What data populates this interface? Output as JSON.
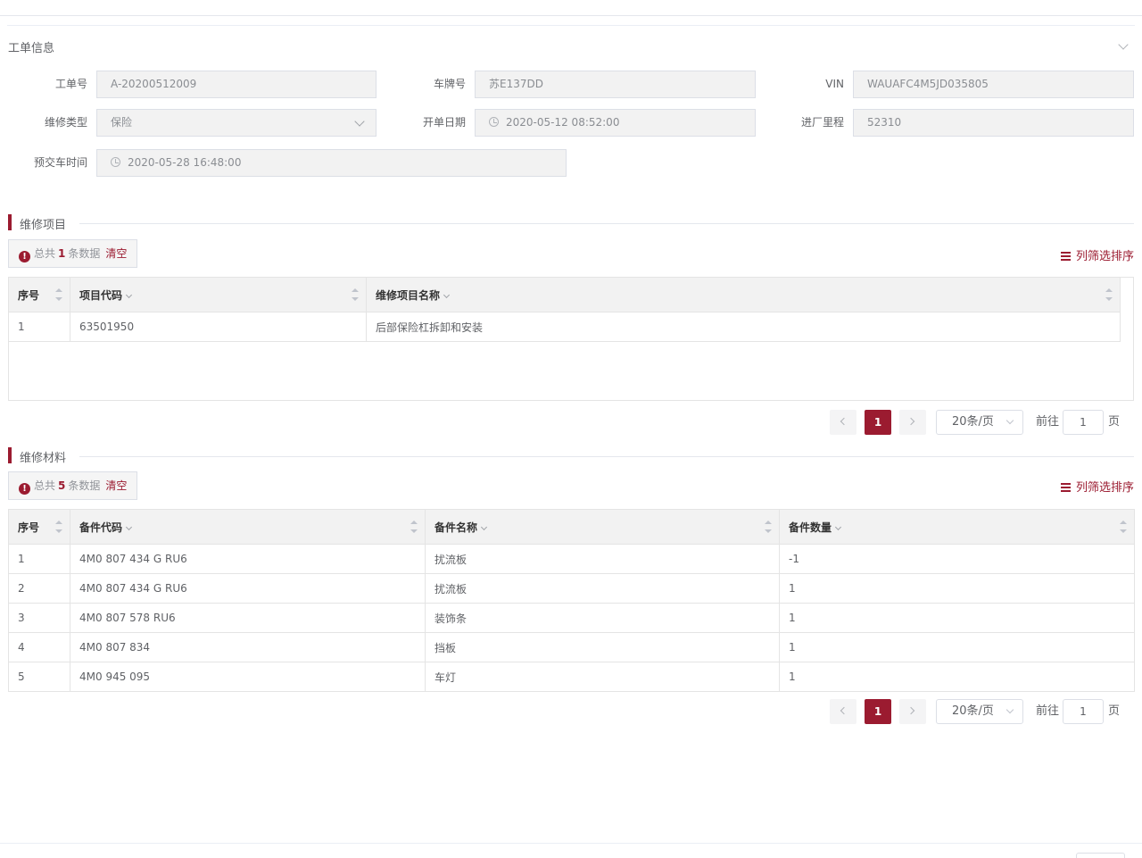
{
  "work_order": {
    "section_title": "工单信息",
    "order_no_label": "工单号",
    "order_no": "A-20200512009",
    "plate_label": "车牌号",
    "plate": "苏E137DD",
    "vin_label": "VIN",
    "vin": "WAUAFC4M5JD035805",
    "repair_type_label": "维修类型",
    "repair_type": "保险",
    "open_date_label": "开单日期",
    "open_date": "2020-05-12 08:52:00",
    "mileage_label": "进厂里程",
    "mileage": "52310",
    "delivery_label": "预交车时间",
    "delivery_time": "2020-05-28 16:48:00"
  },
  "repair_items": {
    "title": "维修项目",
    "summary": {
      "prefix": "总共",
      "count": "1",
      "suffix": "条数据",
      "clear": "清空"
    },
    "column_sort": "列筛选排序",
    "columns": [
      "序号",
      "项目代码",
      "维修项目名称"
    ],
    "rows": [
      [
        "1",
        "63501950",
        "后部保险杠拆卸和安装"
      ]
    ],
    "pager": {
      "current": "1",
      "page_size": "20条/页",
      "goto_label": "前往",
      "goto_value": "1",
      "page_suffix": "页"
    }
  },
  "repair_materials": {
    "title": "维修材料",
    "summary": {
      "prefix": "总共",
      "count": "5",
      "suffix": "条数据",
      "clear": "清空"
    },
    "column_sort": "列筛选排序",
    "columns": [
      "序号",
      "备件代码",
      "备件名称",
      "备件数量"
    ],
    "rows": [
      [
        "1",
        "4M0 807 434 G RU6",
        "扰流板",
        "-1"
      ],
      [
        "2",
        "4M0 807 434 G RU6",
        "扰流板",
        "1"
      ],
      [
        "3",
        "4M0 807 578 RU6",
        "装饰条",
        "1"
      ],
      [
        "4",
        "4M0 807 834",
        "挡板",
        "1"
      ],
      [
        "5",
        "4M0 945 095",
        "车灯",
        "1"
      ]
    ],
    "pager": {
      "current": "1",
      "page_size": "20条/页",
      "goto_label": "前往",
      "goto_value": "1",
      "page_suffix": "页"
    }
  },
  "colors": {
    "accent": "#9b1b30",
    "header_bg": "#f2f2f2",
    "field_bg": "#f2f2f2"
  },
  "icons": [
    "chevron-down-icon",
    "clock-icon",
    "info-icon",
    "filter-list-icon",
    "sort-icon",
    "chevron-left-icon",
    "chevron-right-icon"
  ]
}
